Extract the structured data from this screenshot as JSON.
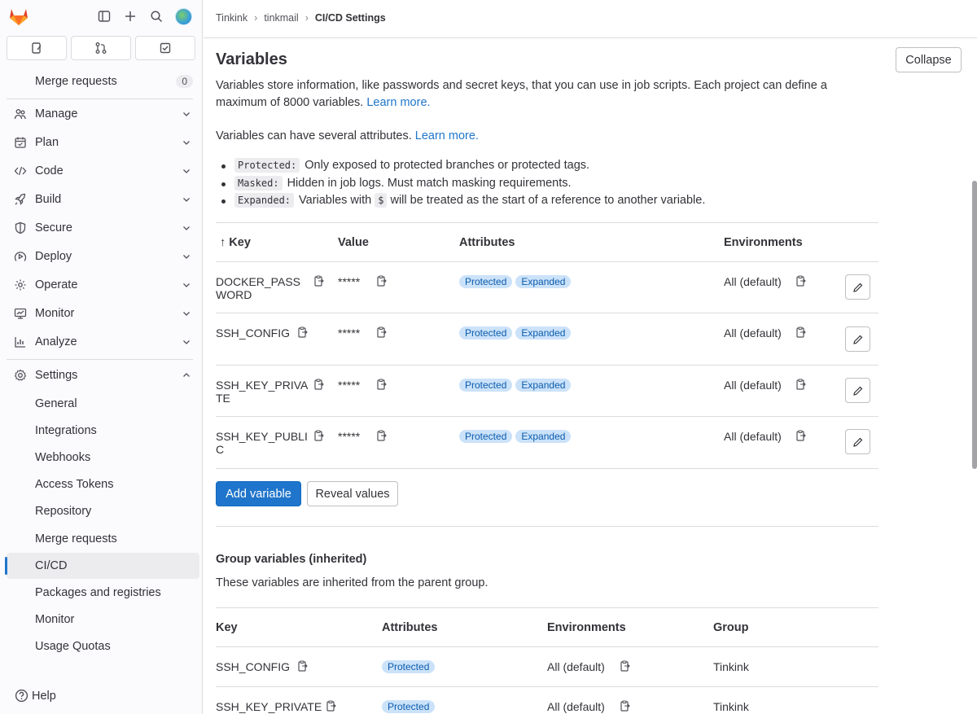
{
  "sidebar": {
    "tabs": [
      "issues-icon",
      "merge-requests-icon",
      "todos-icon"
    ],
    "items": [
      {
        "label": "Merge requests",
        "count": "0"
      },
      {
        "label": "Manage"
      },
      {
        "label": "Plan"
      },
      {
        "label": "Code"
      },
      {
        "label": "Build"
      },
      {
        "label": "Secure"
      },
      {
        "label": "Deploy"
      },
      {
        "label": "Operate"
      },
      {
        "label": "Monitor"
      },
      {
        "label": "Analyze"
      },
      {
        "label": "Settings"
      }
    ],
    "settings_sub": [
      "General",
      "Integrations",
      "Webhooks",
      "Access Tokens",
      "Repository",
      "Merge requests",
      "CI/CD",
      "Packages and registries",
      "Monitor",
      "Usage Quotas"
    ],
    "help": "Help"
  },
  "breadcrumb": [
    "Tinkink",
    "tinkmail",
    "CI/CD Settings"
  ],
  "section": {
    "title": "Variables",
    "collapse": "Collapse",
    "desc1": "Variables store information, like passwords and secret keys, that you can use in job scripts. Each project can define a",
    "desc2": "maximum of 8000 variables.",
    "learn_more": "Learn more.",
    "desc3": "Variables can have several attributes.",
    "bullets": [
      {
        "code": "Protected:",
        "text": "Only exposed to protected branches or protected tags."
      },
      {
        "code": "Masked:",
        "text": "Hidden in job logs. Must match masking requirements."
      },
      {
        "code": "Expanded:",
        "text_a": "Variables with",
        "code2": "$",
        "text_b": "will be treated as the start of a reference to another variable."
      }
    ]
  },
  "table": {
    "headers": {
      "key": "Key",
      "value": "Value",
      "attributes": "Attributes",
      "environments": "Environments"
    },
    "rows": [
      {
        "key_a": "DOCKER_PASS",
        "key_b": "WORD",
        "value": "*****",
        "badges": [
          "Protected",
          "Expanded"
        ],
        "env": "All (default)"
      },
      {
        "key_a": "SSH_CONFIG",
        "key_b": "",
        "value": "*****",
        "badges": [
          "Protected",
          "Expanded"
        ],
        "env": "All (default)"
      },
      {
        "key_a": "SSH_KEY_PRIVA",
        "key_b": "TE",
        "value": "*****",
        "badges": [
          "Protected",
          "Expanded"
        ],
        "env": "All (default)"
      },
      {
        "key_a": "SSH_KEY_PUBLI",
        "key_b": "C",
        "value": "*****",
        "badges": [
          "Protected",
          "Expanded"
        ],
        "env": "All (default)"
      }
    ],
    "add_variable": "Add variable",
    "reveal_values": "Reveal values"
  },
  "group": {
    "title": "Group variables (inherited)",
    "desc": "These variables are inherited from the parent group.",
    "headers": {
      "key": "Key",
      "attributes": "Attributes",
      "environments": "Environments",
      "group": "Group"
    },
    "rows": [
      {
        "key": "SSH_CONFIG",
        "badge": "Protected",
        "env": "All (default)",
        "group": "Tinkink"
      },
      {
        "key": "SSH_KEY_PRIVATE",
        "badge": "Protected",
        "env": "All (default)",
        "group": "Tinkink"
      }
    ]
  }
}
